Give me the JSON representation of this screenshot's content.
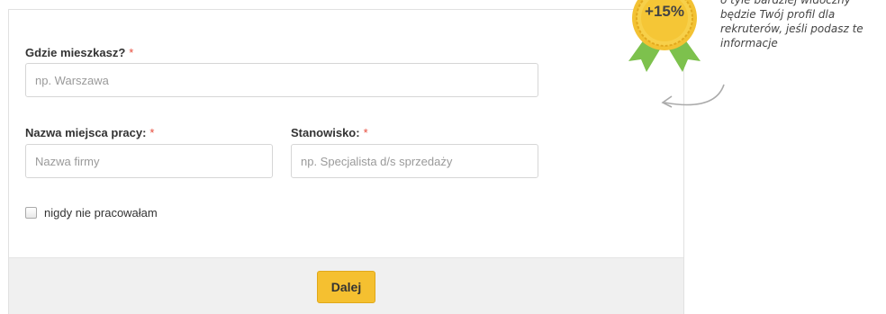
{
  "form": {
    "location": {
      "label": "Gdzie mieszkasz?",
      "required_mark": "*",
      "placeholder": "np. Warszawa",
      "value": ""
    },
    "workplace": {
      "label": "Nazwa miejsca pracy:",
      "required_mark": "*",
      "placeholder": "Nazwa firmy",
      "value": ""
    },
    "position": {
      "label": "Stanowisko:",
      "required_mark": "*",
      "placeholder": "np. Specjalista d/s sprzedaży",
      "value": ""
    },
    "never_worked": {
      "label": "nigdy nie pracowałam",
      "checked": false
    },
    "next_button": "Dalej"
  },
  "promo": {
    "badge_text": "+15%",
    "badge_icon": "award-ribbon-icon",
    "note": "o tyle bardziej widoczny\nbędzie Twój profil dla\nrekruterów, jeśli podasz te\ninformacje",
    "arrow_icon": "curved-arrow-icon"
  },
  "colors": {
    "accent_button": "#f5c030",
    "required": "#e74c3c",
    "badge_gold": "#f3c233",
    "ribbon_green": "#7dc14d"
  }
}
